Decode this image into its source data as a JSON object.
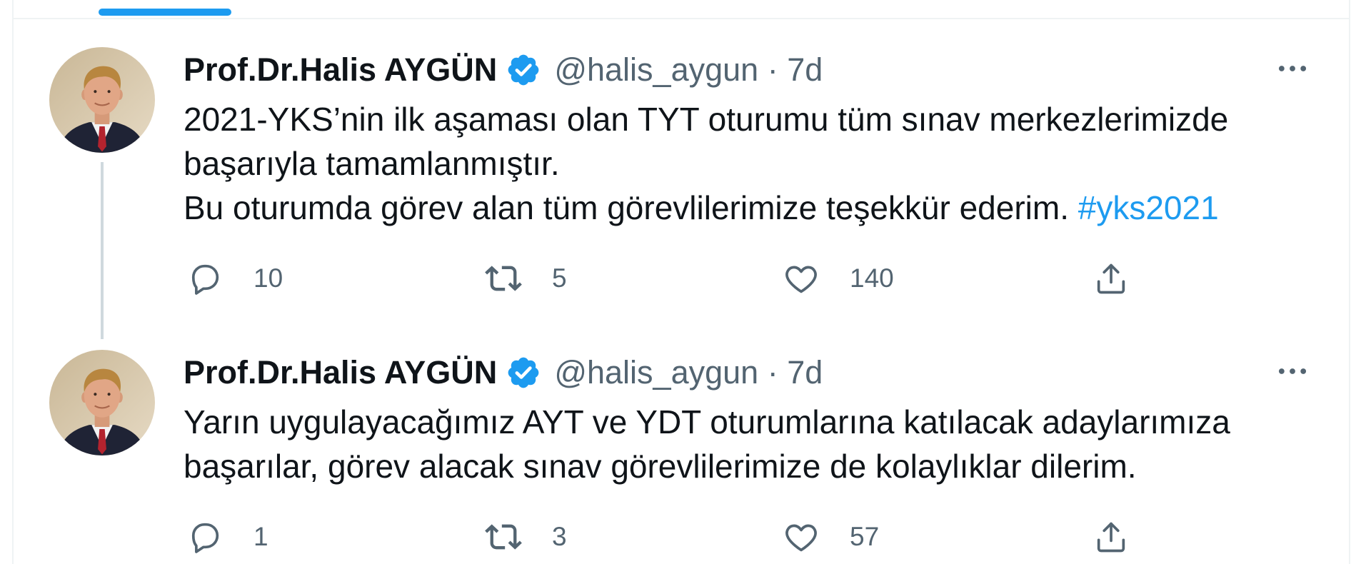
{
  "colors": {
    "accent": "#1d9bf0",
    "text": "#0f1419",
    "secondary": "#536471",
    "border": "#eff3f4",
    "thread_line": "#cfd9de"
  },
  "icons": {
    "reply": "reply-icon",
    "retweet": "retweet-icon",
    "like": "heart-icon",
    "share": "share-icon",
    "more": "more-icon",
    "verified": "verified-badge-icon"
  },
  "tweets": [
    {
      "author": {
        "name": "Prof.Dr.Halis AYGÜN",
        "handle": "@halis_aygun",
        "verified": true
      },
      "separator": "·",
      "time": "7d",
      "text_lines": [
        "2021-YKS’nin ilk aşaması olan TYT oturumu tüm sınav merkezlerimizde",
        "başarıyla tamamlanmıştır.",
        "Bu oturumda görev alan tüm görevlilerimize teşekkür ederim."
      ],
      "hashtag": "#yks2021",
      "stats": {
        "replies": "10",
        "retweets": "5",
        "likes": "140"
      }
    },
    {
      "author": {
        "name": "Prof.Dr.Halis AYGÜN",
        "handle": "@halis_aygun",
        "verified": true
      },
      "separator": "·",
      "time": "7d",
      "text_lines": [
        "Yarın uygulayacağımız AYT ve YDT oturumlarına katılacak adaylarımıza",
        "başarılar, görev alacak sınav görevlilerimize de kolaylıklar dilerim."
      ],
      "stats": {
        "replies": "1",
        "retweets": "3",
        "likes": "57"
      }
    }
  ]
}
